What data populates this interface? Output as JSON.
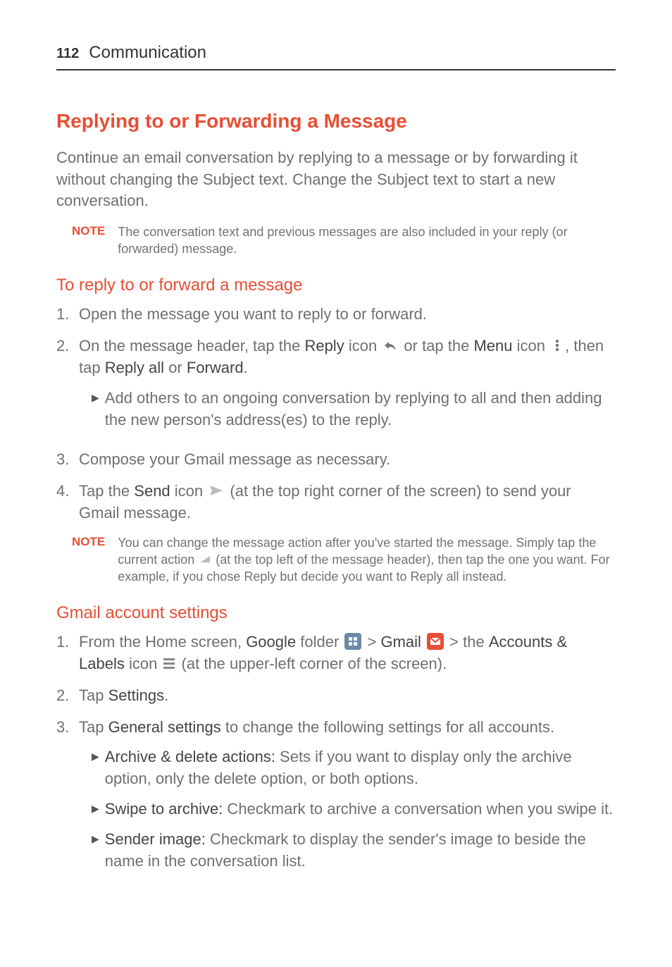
{
  "header": {
    "page_number": "112",
    "section": "Communication"
  },
  "main_title": "Replying to or Forwarding a Message",
  "intro": "Continue an email conversation by replying to a message or by forwarding it without changing the Subject text. Change the Subject text to start a new conversation.",
  "note1": {
    "label": "NOTE",
    "text": "The conversation text and previous messages are also included in your reply (or forwarded) message."
  },
  "sub1_title": "To reply to or forward a message",
  "step1": {
    "num": "1.",
    "text": "Open the message you want to reply to or forward."
  },
  "step2": {
    "num": "2.",
    "p1a": "On the message header, tap the ",
    "reply": "Reply",
    "p1b": " icon ",
    "p1c": " or tap the ",
    "menu": "Menu",
    "p1d": " icon ",
    "p1e": ", then tap ",
    "replyall": "Reply all",
    "or": " or ",
    "forward": "Forward",
    "end": ".",
    "bullet": "Add others to an ongoing conversation by replying to all and then adding the new person's address(es) to the reply."
  },
  "step3": {
    "num": "3.",
    "text": "Compose your Gmail message as necessary."
  },
  "step4": {
    "num": "4.",
    "a": "Tap the ",
    "send": "Send",
    "b": " icon ",
    "c": " (at the top right corner of the screen) to send your Gmail message."
  },
  "note2": {
    "label": "NOTE",
    "a": "You can change the message action after you've started the message. Simply tap the current action ",
    "b": " (at the top left of the message header), then tap the one you want. For example, if you chose Reply but decide you want to Reply all instead."
  },
  "sub2_title": "Gmail account settings",
  "g_step1": {
    "num": "1.",
    "a": "From the Home screen, ",
    "google": "Google",
    "b": " folder ",
    "gt1": " > ",
    "gmail": "Gmail",
    "gt2": " > the ",
    "accounts": "Accounts & Labels",
    "c": " icon ",
    "d": " (at the upper-left corner of the screen)."
  },
  "g_step2": {
    "num": "2.",
    "a": "Tap ",
    "settings": "Settings",
    "b": "."
  },
  "g_step3": {
    "num": "3.",
    "a": "Tap ",
    "general": "General settings",
    "b": " to change the following settings for all accounts.",
    "bullets": [
      {
        "title": "Archive & delete actions:",
        "text": " Sets if you want to display only the archive option, only the delete option, or both options."
      },
      {
        "title": "Swipe to archive:",
        "text": " Checkmark to archive a conversation when you swipe it."
      },
      {
        "title": "Sender image:",
        "text": " Checkmark to display the sender's image to beside the name in the conversation list."
      }
    ]
  }
}
